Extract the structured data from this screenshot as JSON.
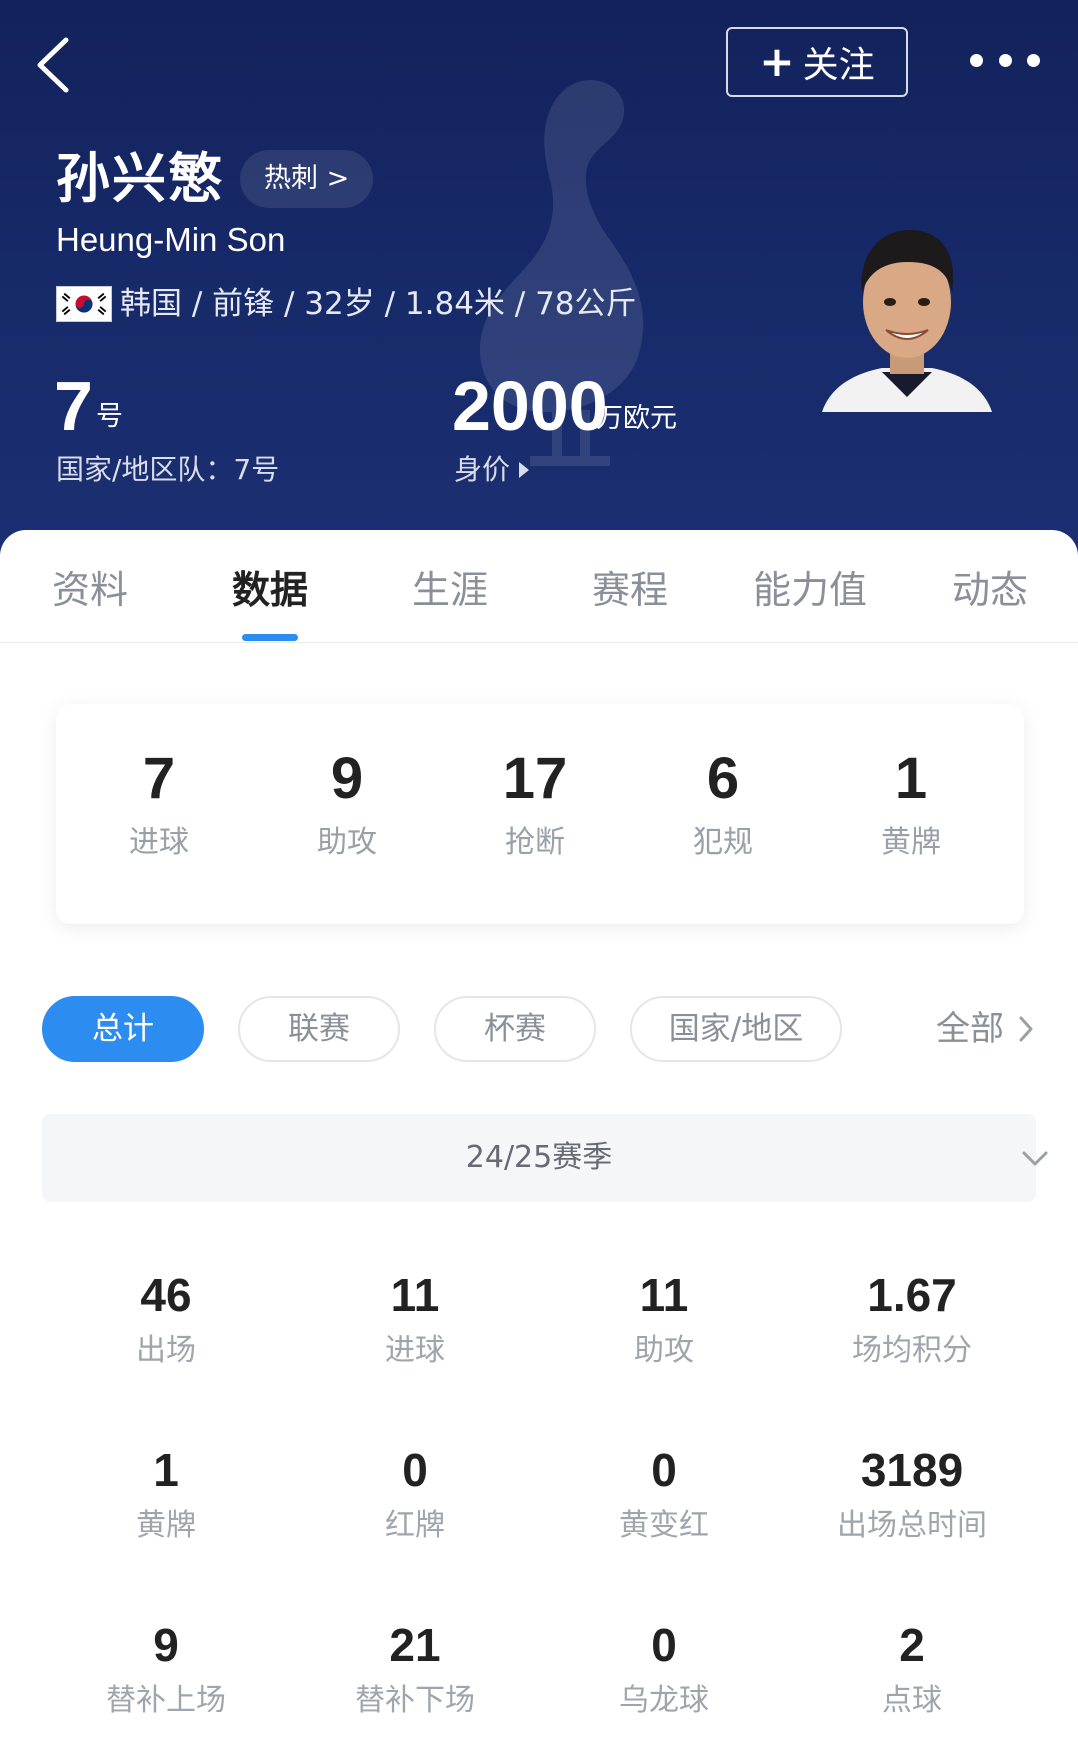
{
  "header": {
    "follow_label": "关注",
    "name_cn": "孙兴慜",
    "team_chip": "热刺 >",
    "name_en": "Heung-Min Son",
    "info_line": "韩国 / 前锋 / 32岁 / 1.84米 / 78公斤",
    "shirt_number": "7",
    "shirt_unit": "号",
    "national_team_line": "国家/地区队：7号",
    "market_value": "2000",
    "market_value_unit": "万欧元",
    "market_value_label": "身价"
  },
  "tabs": [
    {
      "label": "资料",
      "active": false
    },
    {
      "label": "数据",
      "active": true
    },
    {
      "label": "生涯",
      "active": false
    },
    {
      "label": "赛程",
      "active": false
    },
    {
      "label": "能力值",
      "active": false
    },
    {
      "label": "动态",
      "active": false
    }
  ],
  "summary": [
    {
      "value": "7",
      "label": "进球"
    },
    {
      "value": "9",
      "label": "助攻"
    },
    {
      "value": "17",
      "label": "抢断"
    },
    {
      "value": "6",
      "label": "犯规"
    },
    {
      "value": "1",
      "label": "黄牌"
    }
  ],
  "filters": [
    {
      "label": "总计",
      "active": true
    },
    {
      "label": "联赛",
      "active": false
    },
    {
      "label": "杯赛",
      "active": false
    },
    {
      "label": "国家/地区",
      "active": false
    }
  ],
  "all_label": "全部",
  "season": "24/25赛季",
  "stats": [
    {
      "value": "46",
      "label": "出场"
    },
    {
      "value": "11",
      "label": "进球"
    },
    {
      "value": "11",
      "label": "助攻"
    },
    {
      "value": "1.67",
      "label": "场均积分"
    },
    {
      "value": "1",
      "label": "黄牌"
    },
    {
      "value": "0",
      "label": "红牌"
    },
    {
      "value": "0",
      "label": "黄变红"
    },
    {
      "value": "3189",
      "label": "出场总时间"
    },
    {
      "value": "9",
      "label": "替补上场"
    },
    {
      "value": "21",
      "label": "替补下场"
    },
    {
      "value": "0",
      "label": "乌龙球"
    },
    {
      "value": "2",
      "label": "点球"
    }
  ],
  "colors": {
    "header_bg": "#172a6a",
    "accent": "#2d8cf0",
    "muted_text": "#9aa0a8"
  },
  "icons": [
    "back-arrow-icon",
    "plus-icon",
    "more-dots-icon",
    "korea-flag-icon",
    "caret-right-icon",
    "chevron-right-icon",
    "chevron-down-icon",
    "team-crest-watermark"
  ]
}
